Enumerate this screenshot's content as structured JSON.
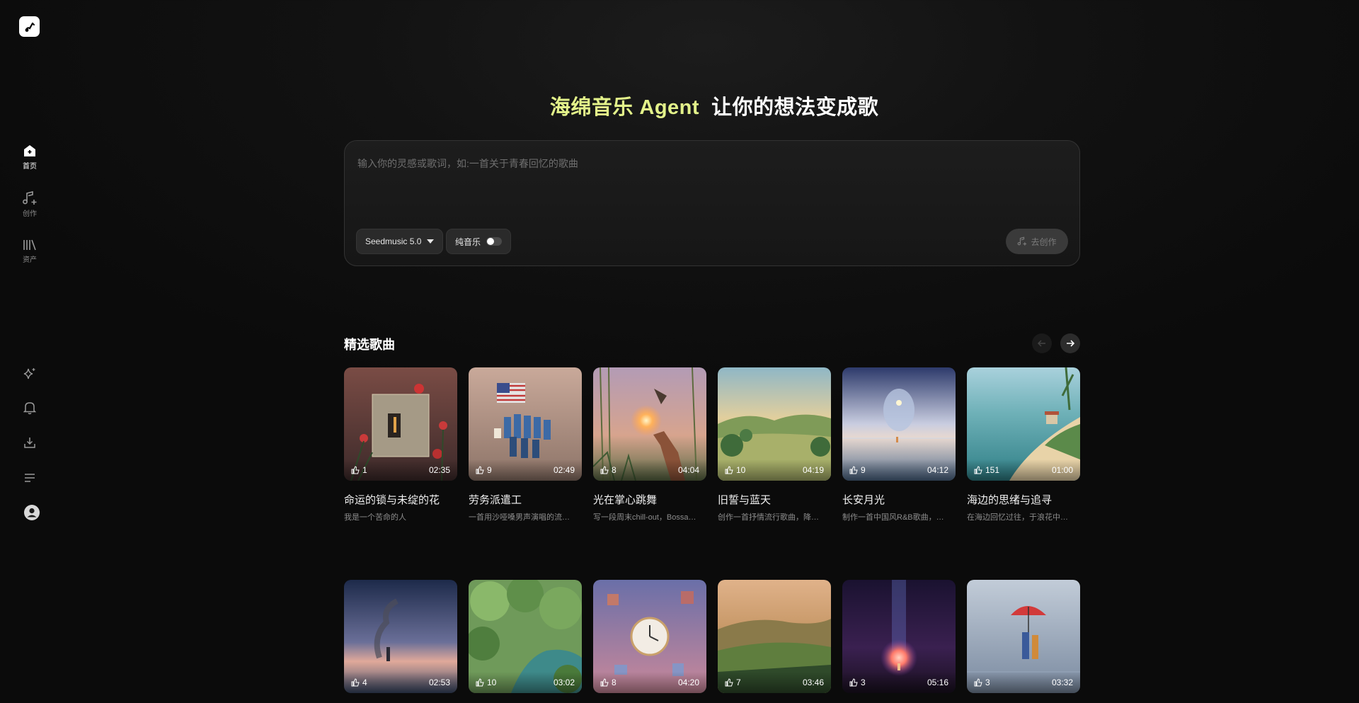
{
  "sidebar": {
    "logo_icon": "music-note-icon",
    "nav": [
      {
        "label": "首页",
        "icon": "home-icon",
        "active": true
      },
      {
        "label": "创作",
        "icon": "music-plus-icon",
        "active": false
      },
      {
        "label": "资产",
        "icon": "library-icon",
        "active": false
      }
    ],
    "bottom_icons": [
      "sparkle-icon",
      "bell-icon",
      "download-icon",
      "list-icon",
      "user-icon"
    ]
  },
  "hero": {
    "title_accent": "海绵音乐 Agent",
    "title_rest": "让你的想法变成歌"
  },
  "prompt": {
    "placeholder": "输入你的灵感或歌词，如:一首关于青春回忆的歌曲",
    "model_label": "Seedmusic 5.0",
    "instrumental_label": "纯音乐",
    "instrumental_on": false,
    "create_label": "去创作"
  },
  "featured": {
    "title": "精选歌曲",
    "row1": [
      {
        "likes": "1",
        "duration": "02:35",
        "title": "命运的锁与未绽的花",
        "desc": "我是一个苦命的人"
      },
      {
        "likes": "9",
        "duration": "02:49",
        "title": "劳务派遣工",
        "desc": "一首用沙哑嗓男声演唱的流…"
      },
      {
        "likes": "8",
        "duration": "04:04",
        "title": "光在掌心跳舞",
        "desc": "写一段周末chill-out，Bossa…"
      },
      {
        "likes": "10",
        "duration": "04:19",
        "title": "旧誓与蓝天",
        "desc": "创作一首抒情流行歌曲，降…"
      },
      {
        "likes": "9",
        "duration": "04:12",
        "title": "长安月光",
        "desc": "制作一首中国风R&B歌曲，…"
      },
      {
        "likes": "151",
        "duration": "01:00",
        "title": "海边的思绪与追寻",
        "desc": "在海边回忆过往，于浪花中…"
      }
    ],
    "row2": [
      {
        "likes": "4",
        "duration": "02:53"
      },
      {
        "likes": "10",
        "duration": "03:02"
      },
      {
        "likes": "8",
        "duration": "04:20"
      },
      {
        "likes": "7",
        "duration": "03:46"
      },
      {
        "likes": "3",
        "duration": "05:16"
      },
      {
        "likes": "3",
        "duration": "03:32"
      }
    ]
  }
}
